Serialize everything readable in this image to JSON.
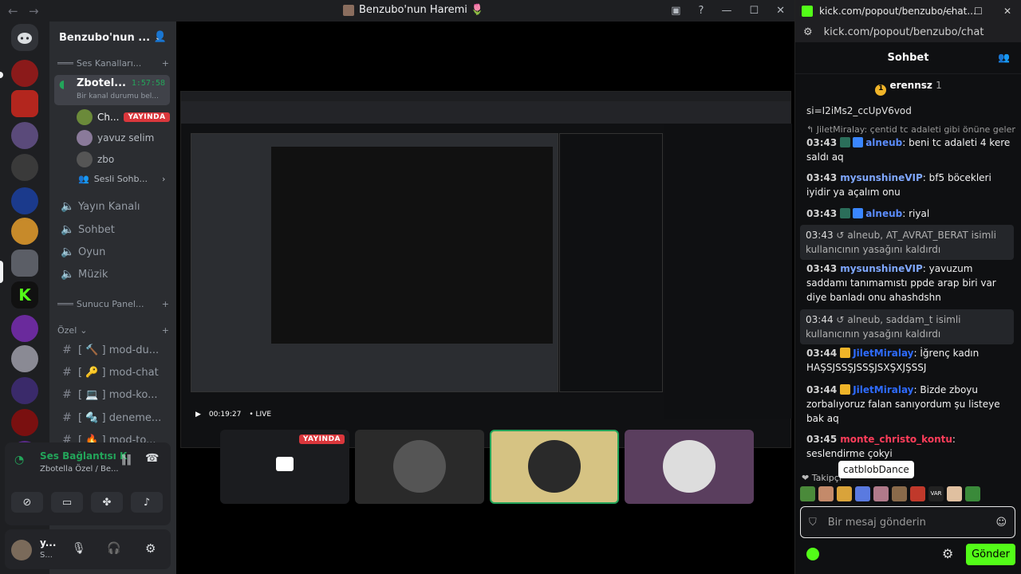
{
  "discord": {
    "window_title": "Benzubo'nun Haremi 🌷",
    "server_name": "Benzubo'nun ...",
    "categories": {
      "voice": "Ses Kanalları...",
      "server_panel": "Sunucu Panel...",
      "private": "Özel"
    },
    "active_voice": {
      "name": "Zbotel...",
      "timer": "1:57:58",
      "status": "Bir kanal durumu bel..."
    },
    "voice_users": [
      {
        "name": "Ch...",
        "badge": "YAYINDA"
      },
      {
        "name": "yavuz selim"
      },
      {
        "name": "zbo"
      }
    ],
    "voice_extra": "Sesli Sohb...",
    "channels": [
      "Yayın Kanalı",
      "Sohbet",
      "Oyun",
      "Müzik"
    ],
    "private_channels": [
      "[ 🔨 ] mod-du...",
      "[ 🔑 ] mod-chat",
      "[ 💻 ] mod-ko...",
      "[ 🔩 ] deneme...",
      "[ 🔥 ] mod-to..."
    ],
    "voice_panel": {
      "title": "Ses Bağlantısı K",
      "sub": "Zbotella Özel / Be..."
    },
    "user_panel": {
      "name": "y...",
      "status": "S..."
    },
    "live_label": "YAYINDA",
    "inner_stream_time": "00:19:27",
    "inner_live": "• LIVE"
  },
  "kick": {
    "window_title": "kick.com/popout/benzubo/chat...",
    "address": "kick.com/popout/benzubo/chat",
    "header": "Sohbet",
    "pinned": {
      "name": "erennsz",
      "count": "1"
    },
    "partial_link": "si=I2iMs2_ccUpV6vod",
    "reply_preview": "JiletMiralay: çentid tc adaleti gibi önüne geleni s...",
    "messages": [
      {
        "time": "03:43",
        "user": "alneub",
        "color": "#5b8cff",
        "text": ": beni tc adaleti 4 kere saldı aq"
      },
      {
        "time": "03:43",
        "user": "mysunshineVIP",
        "color": "#7fa7ff",
        "text": ": bf5 böcekleri iyidir ya açalım onu"
      },
      {
        "time": "03:43",
        "user": "alneub",
        "color": "#5b8cff",
        "text": ": riyal"
      },
      {
        "time": "03:43",
        "sys": true,
        "text": "alneub, AT_AVRAT_BERAT isimli kullanıcının yasağını kaldırdı"
      },
      {
        "time": "03:43",
        "user": "mysunshineVIP",
        "color": "#7fa7ff",
        "text": ": yavuzum saddamı tanımamıstı ppde arap biri var diye banladı onu ahashdshn"
      },
      {
        "time": "03:44",
        "sys": true,
        "text": "alneub, saddam_t isimli kullanıcının yasağını kaldırdı"
      },
      {
        "time": "03:44",
        "user": "JiletMiralay",
        "color": "#2e6bff",
        "text": ": İğrenç kadın HAŞSJSSŞJSSŞJSXŞXJŞSSJ"
      },
      {
        "time": "03:44",
        "user": "JiletMiralay",
        "color": "#2e6bff",
        "text": ": Bizde zboyu zorbalıyoruz falan sanıyordum şu listeye bak aq"
      },
      {
        "time": "03:45",
        "user": "monte_christo_kontu",
        "color": "#ff3d5a",
        "text": ": seslendirme çokyi"
      }
    ],
    "followers_label": "Takipçi",
    "tooltip": "catblobDance",
    "input_placeholder": "Bir mesaj gönderin",
    "send": "Gönder"
  }
}
